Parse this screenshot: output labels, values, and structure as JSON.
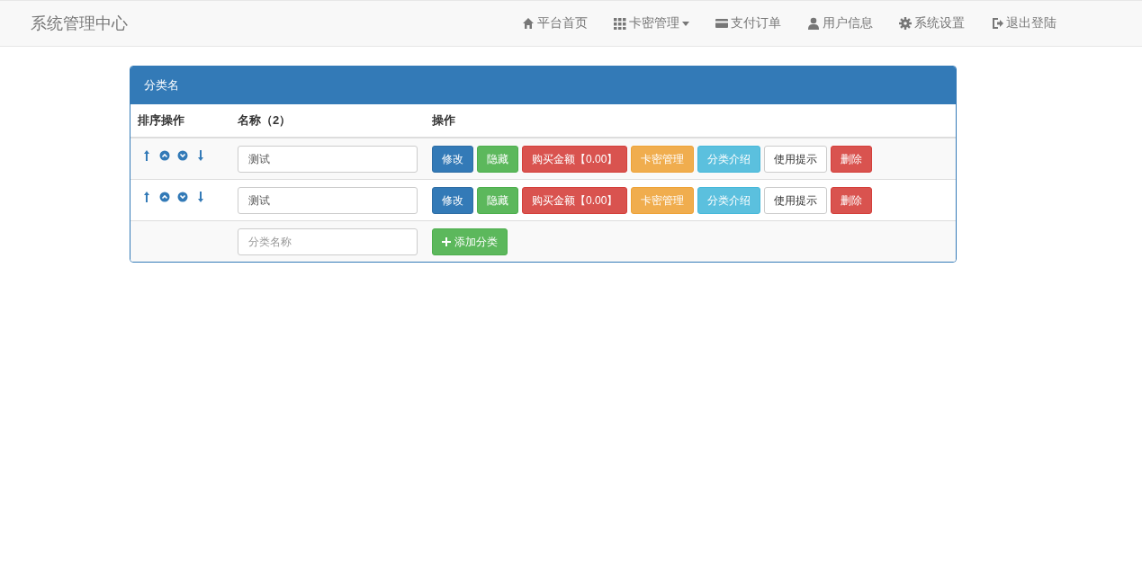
{
  "brand": "系统管理中心",
  "nav": [
    {
      "label": "平台首页",
      "kind": "home",
      "caret": false
    },
    {
      "label": "卡密管理",
      "kind": "grid",
      "caret": true
    },
    {
      "label": "支付订单",
      "kind": "card",
      "caret": false
    },
    {
      "label": "用户信息",
      "kind": "user",
      "caret": false
    },
    {
      "label": "系统设置",
      "kind": "gear",
      "caret": false
    },
    {
      "label": "退出登陆",
      "kind": "logout",
      "caret": false
    }
  ],
  "panel": {
    "title": "分类名",
    "columns": [
      "排序操作",
      "名称（2）",
      "操作"
    ],
    "rows": [
      {
        "name": "测试",
        "actions": [
          {
            "label": "修改",
            "kind": "primary"
          },
          {
            "label": "隐藏",
            "kind": "success"
          },
          {
            "label": "购买金额【0.00】",
            "kind": "danger"
          },
          {
            "label": "卡密管理",
            "kind": "warning"
          },
          {
            "label": "分类介绍",
            "kind": "info"
          },
          {
            "label": "使用提示",
            "kind": "default"
          },
          {
            "label": "删除",
            "kind": "danger"
          }
        ]
      },
      {
        "name": "测试",
        "actions": [
          {
            "label": "修改",
            "kind": "primary"
          },
          {
            "label": "隐藏",
            "kind": "success"
          },
          {
            "label": "购买金额【0.00】",
            "kind": "danger"
          },
          {
            "label": "卡密管理",
            "kind": "warning"
          },
          {
            "label": "分类介绍",
            "kind": "info"
          },
          {
            "label": "使用提示",
            "kind": "default"
          },
          {
            "label": "删除",
            "kind": "danger"
          }
        ]
      }
    ],
    "add": {
      "placeholder": "分类名称",
      "button": "添加分类"
    }
  }
}
